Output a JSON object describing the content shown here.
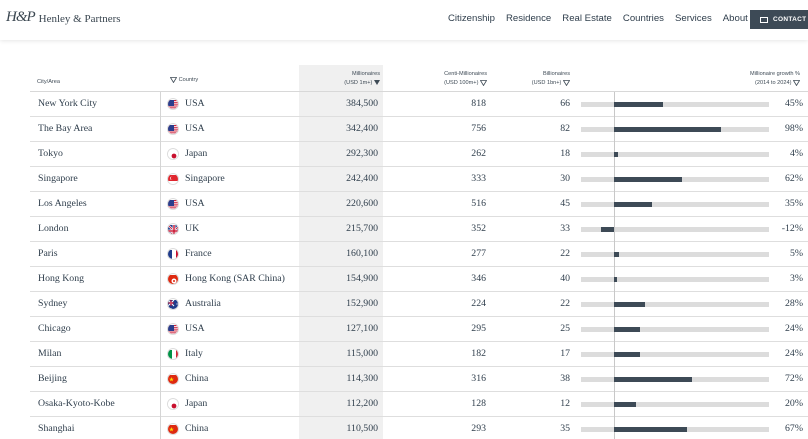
{
  "brand": {
    "mark": "H&P",
    "name": "Henley & Partners"
  },
  "nav": [
    "Citizenship",
    "Residence",
    "Real Estate",
    "Countries",
    "Services",
    "About"
  ],
  "contact_label": "CONTACT",
  "headers": {
    "city": "City/Area",
    "country": "Country",
    "millionaires": "Millionaires",
    "millionaires_unit": "(USD 1m+)",
    "centi": "Centi-Millionaires",
    "centi_unit": "(USD 100m+)",
    "billionaires": "Billionaires",
    "billionaires_unit": "(USD 1bn+)",
    "growth": "Millionaire growth %",
    "growth_unit": "(2014 to 2024)"
  },
  "colors": {
    "accent": "#3d4a56",
    "track": "#dcdcdc",
    "highlight_column": "#f0f0f0"
  },
  "rows": [
    {
      "city": "New York City",
      "country": "USA",
      "flag": "us-flag-icon",
      "millionaires": "384,500",
      "centi": "818",
      "billionaires": "66",
      "growth_label": "45%",
      "growth": 45
    },
    {
      "city": "The Bay Area",
      "country": "USA",
      "flag": "us-flag-icon",
      "millionaires": "342,400",
      "centi": "756",
      "billionaires": "82",
      "growth_label": "98%",
      "growth": 98
    },
    {
      "city": "Tokyo",
      "country": "Japan",
      "flag": "japan-flag-icon",
      "millionaires": "292,300",
      "centi": "262",
      "billionaires": "18",
      "growth_label": "4%",
      "growth": 4
    },
    {
      "city": "Singapore",
      "country": "Singapore",
      "flag": "singapore-flag-icon",
      "millionaires": "242,400",
      "centi": "333",
      "billionaires": "30",
      "growth_label": "62%",
      "growth": 62
    },
    {
      "city": "Los Angeles",
      "country": "USA",
      "flag": "us-flag-icon",
      "millionaires": "220,600",
      "centi": "516",
      "billionaires": "45",
      "growth_label": "35%",
      "growth": 35
    },
    {
      "city": "London",
      "country": "UK",
      "flag": "uk-flag-icon",
      "millionaires": "215,700",
      "centi": "352",
      "billionaires": "33",
      "growth_label": "-12%",
      "growth": -12
    },
    {
      "city": "Paris",
      "country": "France",
      "flag": "france-flag-icon",
      "millionaires": "160,100",
      "centi": "277",
      "billionaires": "22",
      "growth_label": "5%",
      "growth": 5
    },
    {
      "city": "Hong Kong",
      "country": "Hong Kong (SAR China)",
      "flag": "hong-kong-flag-icon",
      "millionaires": "154,900",
      "centi": "346",
      "billionaires": "40",
      "growth_label": "3%",
      "growth": 3
    },
    {
      "city": "Sydney",
      "country": "Australia",
      "flag": "australia-flag-icon",
      "millionaires": "152,900",
      "centi": "224",
      "billionaires": "22",
      "growth_label": "28%",
      "growth": 28
    },
    {
      "city": "Chicago",
      "country": "USA",
      "flag": "us-flag-icon",
      "millionaires": "127,100",
      "centi": "295",
      "billionaires": "25",
      "growth_label": "24%",
      "growth": 24
    },
    {
      "city": "Milan",
      "country": "Italy",
      "flag": "italy-flag-icon",
      "millionaires": "115,000",
      "centi": "182",
      "billionaires": "17",
      "growth_label": "24%",
      "growth": 24
    },
    {
      "city": "Beijing",
      "country": "China",
      "flag": "china-flag-icon",
      "millionaires": "114,300",
      "centi": "316",
      "billionaires": "38",
      "growth_label": "72%",
      "growth": 72
    },
    {
      "city": "Osaka-Kyoto-Kobe",
      "country": "Japan",
      "flag": "japan-flag-icon",
      "millionaires": "112,200",
      "centi": "128",
      "billionaires": "12",
      "growth_label": "20%",
      "growth": 20
    },
    {
      "city": "Shanghai",
      "country": "China",
      "flag": "china-flag-icon",
      "millionaires": "110,500",
      "centi": "293",
      "billionaires": "35",
      "growth_label": "67%",
      "growth": 67
    }
  ]
}
